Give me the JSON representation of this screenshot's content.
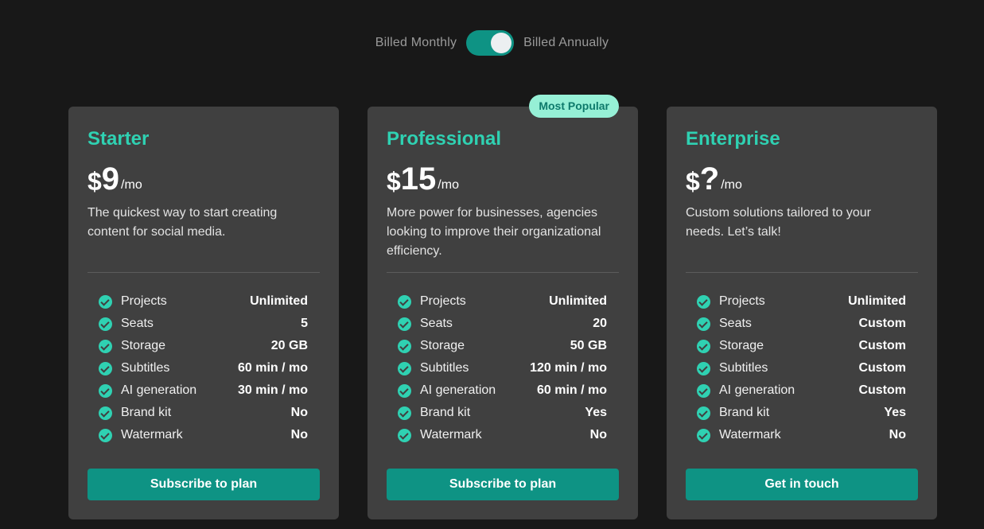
{
  "billing": {
    "monthly_label": "Billed Monthly",
    "annual_label": "Billed Annually",
    "toggle_state": "annual"
  },
  "colors": {
    "page_bg": "#181818",
    "card_bg": "#404040",
    "accent": "#2fd1b2",
    "button": "#0e9384",
    "badge_bg": "#96f0d6"
  },
  "plans": [
    {
      "name": "Starter",
      "currency": "$",
      "amount": "9",
      "period": "/mo",
      "description": "The quickest way to start creating content for social media.",
      "features": [
        {
          "label": "Projects",
          "value": "Unlimited"
        },
        {
          "label": "Seats",
          "value": "5"
        },
        {
          "label": "Storage",
          "value": "20 GB"
        },
        {
          "label": "Subtitles",
          "value": "60 min / mo"
        },
        {
          "label": "AI generation",
          "value": "30 min / mo"
        },
        {
          "label": "Brand kit",
          "value": "No"
        },
        {
          "label": "Watermark",
          "value": "No"
        }
      ],
      "cta": "Subscribe to plan"
    },
    {
      "name": "Professional",
      "badge": "Most Popular",
      "currency": "$",
      "amount": "15",
      "period": "/mo",
      "description": "More power for businesses, agencies looking to improve their organizational efficiency.",
      "features": [
        {
          "label": "Projects",
          "value": "Unlimited"
        },
        {
          "label": "Seats",
          "value": "20"
        },
        {
          "label": "Storage",
          "value": "50 GB"
        },
        {
          "label": "Subtitles",
          "value": "120 min / mo"
        },
        {
          "label": "AI generation",
          "value": "60 min / mo"
        },
        {
          "label": "Brand kit",
          "value": "Yes"
        },
        {
          "label": "Watermark",
          "value": "No"
        }
      ],
      "cta": "Subscribe to plan"
    },
    {
      "name": "Enterprise",
      "currency": "$",
      "amount": "?",
      "period": "/mo",
      "description": "Custom solutions tailored to your needs. Let’s talk!",
      "features": [
        {
          "label": "Projects",
          "value": "Unlimited"
        },
        {
          "label": "Seats",
          "value": "Custom"
        },
        {
          "label": "Storage",
          "value": "Custom"
        },
        {
          "label": "Subtitles",
          "value": "Custom"
        },
        {
          "label": "AI generation",
          "value": "Custom"
        },
        {
          "label": "Brand kit",
          "value": "Yes"
        },
        {
          "label": "Watermark",
          "value": "No"
        }
      ],
      "cta": "Get in touch"
    }
  ]
}
